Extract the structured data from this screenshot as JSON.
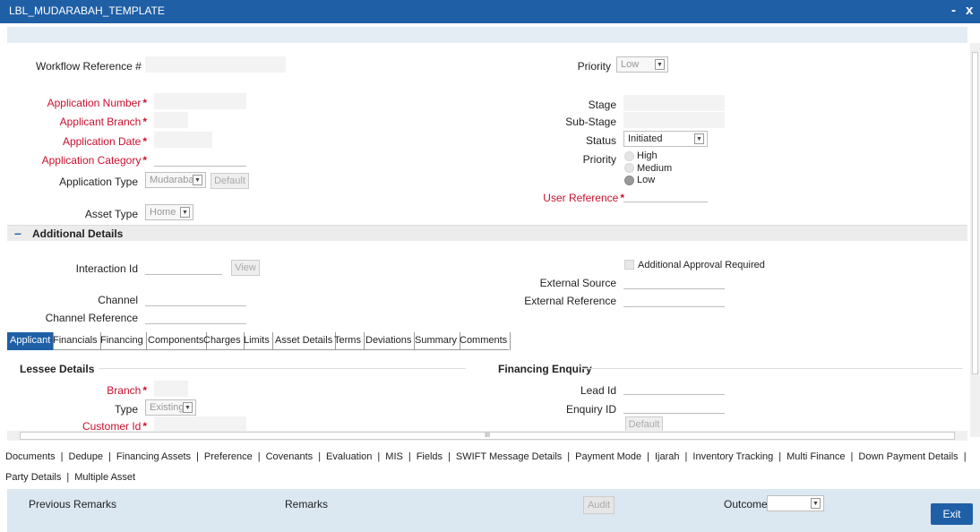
{
  "window": {
    "title": "LBL_MUDARABAH_TEMPLATE",
    "minimize": "-",
    "close": "x"
  },
  "header": {
    "workflow_ref_label": "Workflow Reference #",
    "priority_label": "Priority",
    "priority_value": "Low"
  },
  "app": {
    "app_number_label": "Application Number",
    "applicant_branch_label": "Applicant Branch",
    "app_date_label": "Application Date",
    "app_category_label": "Application Category",
    "app_type_label": "Application Type",
    "app_type_value": "Mudarabah",
    "default_btn": "Default",
    "asset_type_label": "Asset Type",
    "asset_type_value": "Home",
    "required_mark": "*"
  },
  "right": {
    "stage_label": "Stage",
    "sub_stage_label": "Sub-Stage",
    "status_label": "Status",
    "status_value": "Initiated",
    "priority_label": "Priority",
    "priority_options": [
      "High",
      "Medium",
      "Low"
    ],
    "priority_selected": "Low",
    "user_ref_label": "User Reference"
  },
  "additional": {
    "section_title": "Additional Details",
    "collapse_icon": "–",
    "interaction_id_label": "Interaction Id",
    "view_btn": "View",
    "channel_label": "Channel",
    "channel_ref_label": "Channel Reference",
    "approval_label": "Additional Approval Required",
    "ext_source_label": "External Source",
    "ext_ref_label": "External Reference"
  },
  "tabs": [
    "Applicant",
    "Financials",
    "Financing",
    "Components",
    "Charges",
    "Limits",
    "Asset Details",
    "Terms",
    "Deviations",
    "Summary",
    "Comments"
  ],
  "applicant": {
    "lessee_title": "Lessee Details",
    "branch_label": "Branch",
    "type_label": "Type",
    "type_value": "Existing",
    "customer_id_label": "Customer Id",
    "fin_enquiry_title": "Financing Enquiry",
    "lead_id_label": "Lead Id",
    "enquiry_id_label": "Enquiry ID",
    "default_btn": "Default"
  },
  "scroll_grip": "III",
  "bottom_links_row1": [
    "Documents",
    "Dedupe",
    "Financing Assets",
    "Preference",
    "Covenants",
    "Evaluation",
    "MIS",
    "Fields",
    "SWIFT Message Details",
    "Payment Mode",
    "Ijarah",
    "Inventory Tracking",
    "Multi Finance",
    "Down Payment Details",
    ""
  ],
  "bottom_links_row2": [
    "Party Details",
    "Multiple Asset"
  ],
  "footer": {
    "prev_remarks": "Previous Remarks",
    "remarks": "Remarks",
    "audit_btn": "Audit",
    "outcome_label": "Outcome",
    "exit_btn": "Exit"
  },
  "colors": {
    "brand": "#1f5fa6",
    "required": "#c8102e"
  }
}
